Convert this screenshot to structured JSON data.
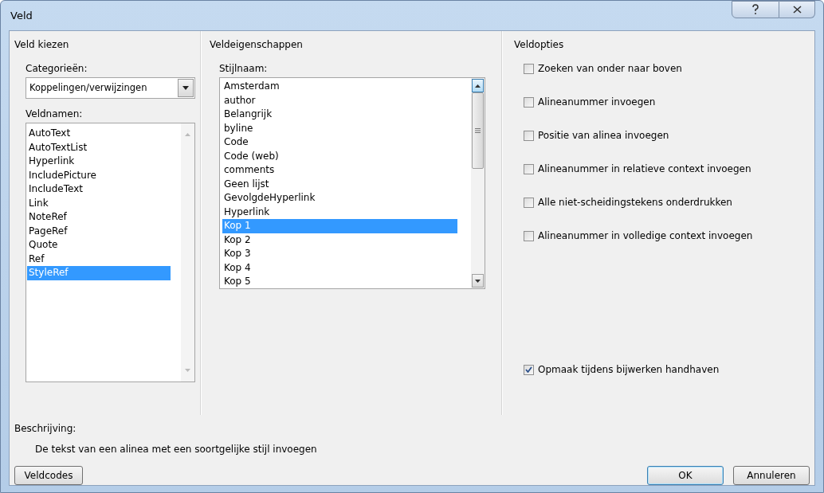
{
  "window": {
    "title": "Veld"
  },
  "field_choice": {
    "heading": "Veld kiezen",
    "categories_label": "Categorieën:",
    "category_value": "Koppelingen/verwijzingen",
    "field_names_label": "Veldnamen:",
    "field_names": [
      {
        "label": "AutoText",
        "selected": false
      },
      {
        "label": "AutoTextList",
        "selected": false
      },
      {
        "label": "Hyperlink",
        "selected": false
      },
      {
        "label": "IncludePicture",
        "selected": false
      },
      {
        "label": "IncludeText",
        "selected": false
      },
      {
        "label": "Link",
        "selected": false
      },
      {
        "label": "NoteRef",
        "selected": false
      },
      {
        "label": "PageRef",
        "selected": false
      },
      {
        "label": "Quote",
        "selected": false
      },
      {
        "label": "Ref",
        "selected": false
      },
      {
        "label": "StyleRef",
        "selected": true
      }
    ]
  },
  "field_properties": {
    "heading": "Veldeigenschappen",
    "style_name_label": "Stijlnaam:",
    "style_names": [
      {
        "label": "Amsterdam",
        "selected": false
      },
      {
        "label": "author",
        "selected": false
      },
      {
        "label": "Belangrijk",
        "selected": false
      },
      {
        "label": "byline",
        "selected": false
      },
      {
        "label": "Code",
        "selected": false
      },
      {
        "label": "Code (web)",
        "selected": false
      },
      {
        "label": "comments",
        "selected": false
      },
      {
        "label": "Geen lijst",
        "selected": false
      },
      {
        "label": "GevolgdeHyperlink",
        "selected": false
      },
      {
        "label": "Hyperlink",
        "selected": false
      },
      {
        "label": "Kop 1",
        "selected": true
      },
      {
        "label": "Kop 2",
        "selected": false
      },
      {
        "label": "Kop 3",
        "selected": false
      },
      {
        "label": "Kop 4",
        "selected": false
      },
      {
        "label": "Kop 5",
        "selected": false
      }
    ]
  },
  "field_options": {
    "heading": "Veldopties",
    "options": [
      {
        "label": "Zoeken van onder naar boven",
        "checked": false
      },
      {
        "label": "Alineanummer invoegen",
        "checked": false
      },
      {
        "label": "Positie van alinea invoegen",
        "checked": false
      },
      {
        "label": "Alineanummer in relatieve context invoegen",
        "checked": false
      },
      {
        "label": "Alle niet-scheidingstekens onderdrukken",
        "checked": false
      },
      {
        "label": "Alineanummer in volledige context invoegen",
        "checked": false
      }
    ],
    "preserve_format": {
      "label": "Opmaak tijdens bijwerken handhaven",
      "checked": true
    }
  },
  "description": {
    "label": "Beschrijving:",
    "text": "De tekst van een alinea met een soortgelijke stijl invoegen"
  },
  "buttons": [
    {
      "label": "Veldcodes",
      "kind": "left",
      "default": false
    },
    {
      "label": "OK",
      "kind": "right",
      "default": true
    },
    {
      "label": "Annuleren",
      "kind": "right",
      "default": false
    }
  ]
}
